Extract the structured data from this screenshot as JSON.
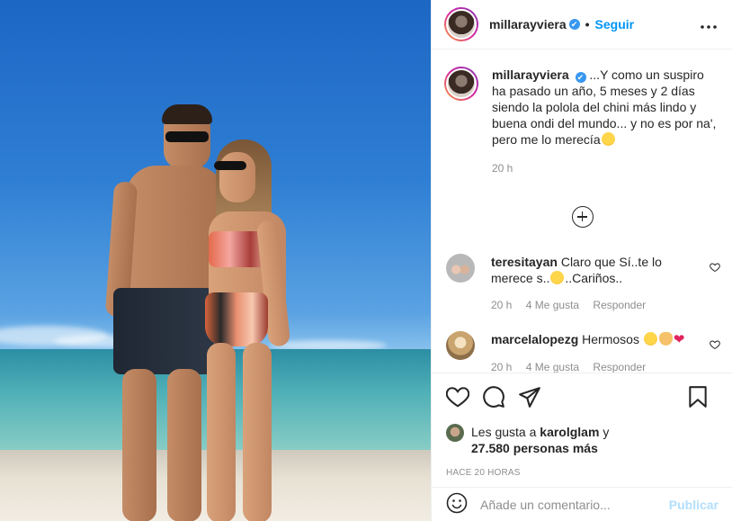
{
  "post": {
    "username": "millarayviera",
    "verified_mark": "✔",
    "dot": "•",
    "follow_label": "Seguir",
    "more_label": "•••",
    "verified_icon": "verified-badge-icon"
  },
  "caption": {
    "username": "millarayviera",
    "text": "...Y como un suspiro ha pasado un año, 5 meses y 2 días siendo la polola del chini más lindo y buena ondi del mundo... y no es por na', pero me lo merecía",
    "emoji": "grimacing-face-emoji",
    "time": "20 h"
  },
  "load_more_icon": "plus-circle-icon",
  "comments": [
    {
      "username": "teresitayan",
      "text_a": "Claro que Sí..te lo merece s..",
      "text_b": "..Cariños..",
      "emoji": "heart-eyes-emoji",
      "time": "20 h",
      "likes": "4 Me gusta",
      "reply": "Responder"
    },
    {
      "username": "marcelalopezg",
      "text": "Hermosos",
      "emojis": [
        "heart-eyes-emoji",
        "clapping-hands-emoji",
        "red-heart-emoji"
      ],
      "time": "20 h",
      "likes": "4 Me gusta",
      "reply": "Responder"
    }
  ],
  "actions": {
    "like_icon": "heart-outline-icon",
    "comment_icon": "comment-bubble-icon",
    "share_icon": "paper-plane-icon",
    "save_icon": "bookmark-icon"
  },
  "likes": {
    "prefix": "Les gusta a",
    "user": "karolglam",
    "conj": "y",
    "count": "27.580 personas más"
  },
  "timestamp": "HACE 20 HORAS",
  "add_comment": {
    "placeholder": "Añade un comentario...",
    "publish_label": "Publicar",
    "emoji_icon": "smiley-face-icon"
  },
  "colors": {
    "accent": "#0095f6",
    "publish_disabled": "#b2dffc",
    "muted": "#8e8e8e",
    "text": "#262626",
    "heart_red": "#ed4956"
  }
}
